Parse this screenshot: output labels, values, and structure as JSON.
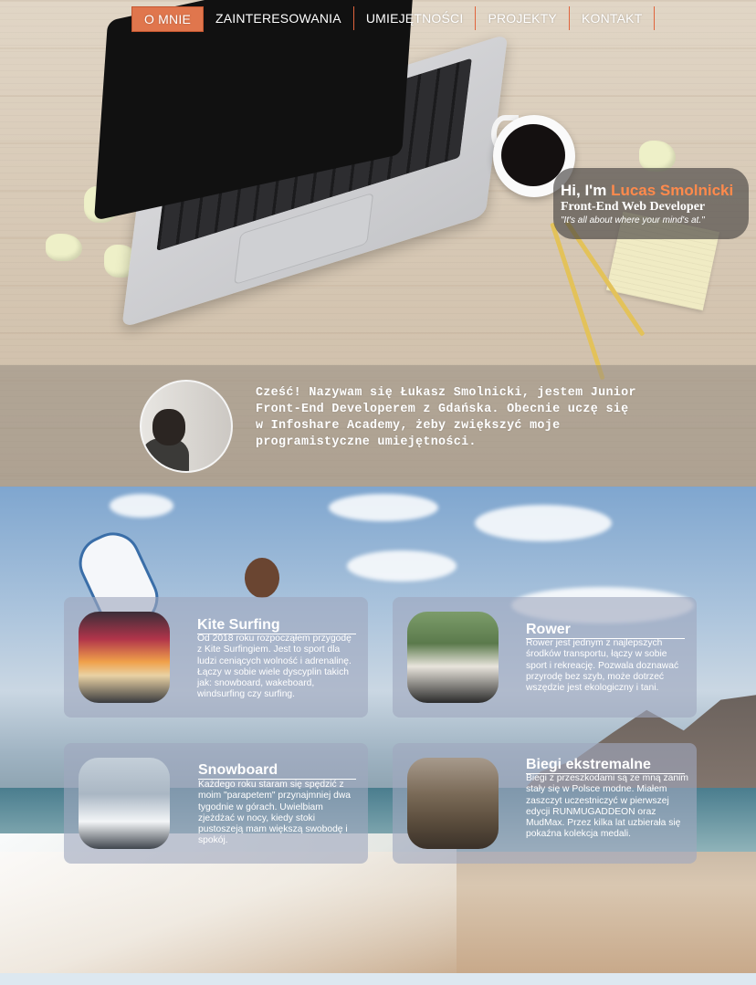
{
  "nav": {
    "items": [
      {
        "label": "O MNIE",
        "active": true
      },
      {
        "label": "ZAINTERESOWANIA",
        "active": false
      },
      {
        "label": "UMIEJĘTNOŚCI",
        "active": false
      },
      {
        "label": "PROJEKTY",
        "active": false
      },
      {
        "label": "KONTAKT",
        "active": false
      }
    ]
  },
  "intro": {
    "greeting": "Hi, I'm ",
    "name": "Lucas Smolnicki",
    "role": "Front-End Web Developer",
    "quote": "\"It's all about where your mind's at.\""
  },
  "about": {
    "text": "Cześć! Nazywam się Łukasz Smolnicki, jestem Junior Front-End Developerem z Gdańska. Obecnie uczę się w Infoshare Academy, żeby zwiększyć moje programistyczne umiejętności."
  },
  "hobbies": [
    {
      "title": "Kite Surfing",
      "text": "Od 2018 roku rozpocząłem przygodę z Kite Surfingiem. Jest to sport dla ludzi ceniących wolność i adrenalinę. Łączy w sobie wiele dyscyplin takich jak: snowboard, wakeboard, windsurfing czy surfing."
    },
    {
      "title": "Rower",
      "text": "Rower jest jednym z najlepszych środków transportu, łączy w sobie sport i rekreację. Pozwala doznawać przyrodę bez szyb, może dotrzeć wszędzie jest ekologiczny i tani."
    },
    {
      "title": "Snowboard",
      "text": "Każdego roku staram się spędzić z moim \"parapetem\" przynajmniej dwa tygodnie w górach. Uwielbiam zjeżdżać w nocy, kiedy stoki pustoszeją mam większą swobodę i spokój."
    },
    {
      "title": "Biegi ekstremalne",
      "text": "Biegi z przeszkodami są ze mną zanim stały się w Polsce modne. Miałem zaszczyt uczestniczyć w pierwszej edycji RUNMUGADDEON oraz MudMax. Przez kilka lat uzbierała się pokaźna kolekcja medali."
    }
  ],
  "colors": {
    "accent": "#e0764d",
    "name_highlight": "#ff8a4c"
  }
}
